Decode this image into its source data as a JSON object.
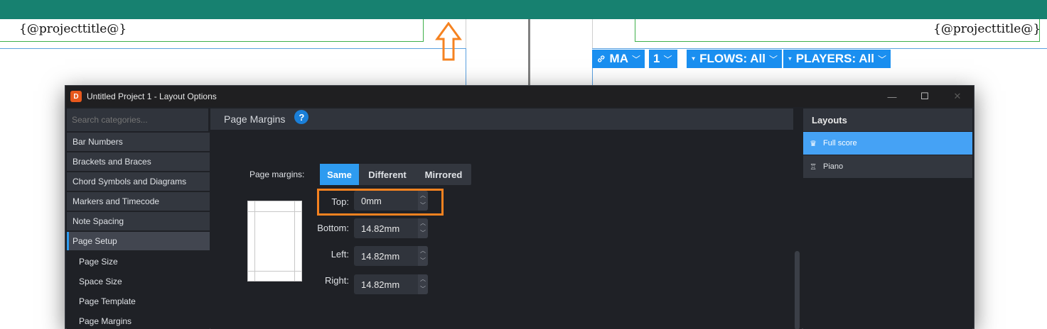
{
  "score": {
    "header_left": "{@projecttitle@}",
    "header_right": "{@projecttitle@}",
    "bar_color": "#178170"
  },
  "toolbar_chips": {
    "ma": "MA",
    "one": "1",
    "flows": "FLOWS: All",
    "players": "PLAYERS: All",
    "accent": "#1a8ff0"
  },
  "dialog": {
    "title": "Untitled Project 1 - Layout Options",
    "app_icon_letter": "D",
    "window_buttons": [
      "—",
      "☐",
      "✕"
    ]
  },
  "sidebar": {
    "search_placeholder": "Search categories...",
    "categories": [
      "Bar Numbers",
      "Brackets and Braces",
      "Chord Symbols and Diagrams",
      "Markers and Timecode",
      "Note Spacing",
      "Page Setup"
    ],
    "active_category": "Page Setup",
    "subitems": [
      "Page Size",
      "Space Size",
      "Page Template",
      "Page Margins"
    ]
  },
  "main": {
    "section_title": "Page Margins",
    "help_label": "?",
    "margins_label": "Page margins:",
    "segments": [
      "Same",
      "Different",
      "Mirrored"
    ],
    "selected_segment": "Same",
    "fields": {
      "top_label": "Top:",
      "top_value": "0mm",
      "bottom_label": "Bottom:",
      "bottom_value": "14.82mm",
      "left_label": "Left:",
      "left_value": "14.82mm",
      "right_label": "Right:",
      "right_value": "14.82mm"
    },
    "highlight_color": "#f58220"
  },
  "layouts": {
    "header": "Layouts",
    "items": [
      "Full score",
      "Piano"
    ],
    "selected": "Full score",
    "selected_color": "#45a2f5"
  }
}
